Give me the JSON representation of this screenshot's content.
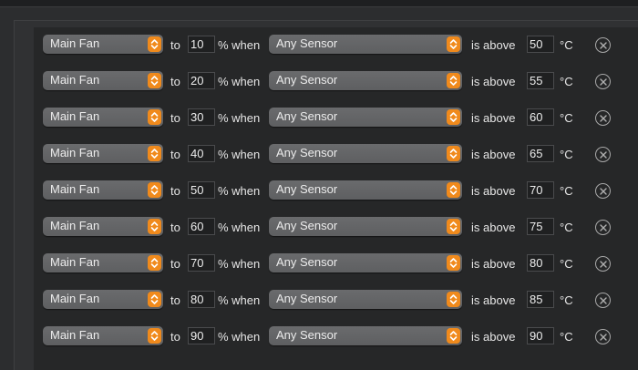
{
  "rules": [
    {
      "fan": "Main Fan",
      "to_label": "to",
      "percent": "10",
      "when_label": "% when",
      "sensor": "Any Sensor",
      "above_label": "is above",
      "temp": "50",
      "unit": "°C"
    },
    {
      "fan": "Main Fan",
      "to_label": "to",
      "percent": "20",
      "when_label": "% when",
      "sensor": "Any Sensor",
      "above_label": "is above",
      "temp": "55",
      "unit": "°C"
    },
    {
      "fan": "Main Fan",
      "to_label": "to",
      "percent": "30",
      "when_label": "% when",
      "sensor": "Any Sensor",
      "above_label": "is above",
      "temp": "60",
      "unit": "°C"
    },
    {
      "fan": "Main Fan",
      "to_label": "to",
      "percent": "40",
      "when_label": "% when",
      "sensor": "Any Sensor",
      "above_label": "is above",
      "temp": "65",
      "unit": "°C"
    },
    {
      "fan": "Main Fan",
      "to_label": "to",
      "percent": "50",
      "when_label": "% when",
      "sensor": "Any Sensor",
      "above_label": "is above",
      "temp": "70",
      "unit": "°C"
    },
    {
      "fan": "Main Fan",
      "to_label": "to",
      "percent": "60",
      "when_label": "% when",
      "sensor": "Any Sensor",
      "above_label": "is above",
      "temp": "75",
      "unit": "°C"
    },
    {
      "fan": "Main Fan",
      "to_label": "to",
      "percent": "70",
      "when_label": "% when",
      "sensor": "Any Sensor",
      "above_label": "is above",
      "temp": "80",
      "unit": "°C"
    },
    {
      "fan": "Main Fan",
      "to_label": "to",
      "percent": "80",
      "when_label": "% when",
      "sensor": "Any Sensor",
      "above_label": "is above",
      "temp": "85",
      "unit": "°C"
    },
    {
      "fan": "Main Fan",
      "to_label": "to",
      "percent": "90",
      "when_label": "% when",
      "sensor": "Any Sensor",
      "above_label": "is above",
      "temp": "90",
      "unit": "°C"
    }
  ],
  "icons": {
    "stepper": "up-down-chevron-icon",
    "remove": "close-circle-icon"
  },
  "colors": {
    "accent": "#f08a1c",
    "panel": "#262728",
    "text": "#e6e6e6"
  }
}
